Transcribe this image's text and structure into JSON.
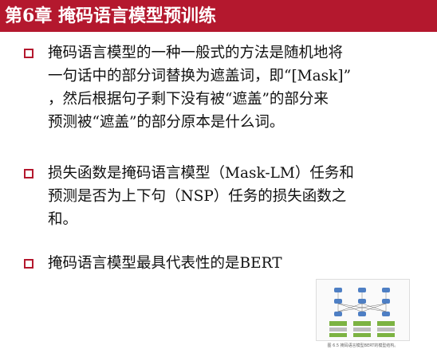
{
  "slide": {
    "title": "第6章 掩码语言模型预训练",
    "bullets": [
      {
        "lines": [
          "掩码语言模型的一种一般式的方法是随机地将",
          "一句话中的部分词替换为遮盖词，即“[Mask]”",
          "，然后根据句子剩下没有被“遮盖”的部分来",
          "预测被“遮盖”的部分原本是什么词。"
        ]
      },
      {
        "lines": [
          "损失函数是掩码语言模型（Mask-LM）任务和",
          "预测是否为上下句（NSP）任务的损失函数之",
          "和。"
        ]
      },
      {
        "lines": [
          "掩码语言模型最具代表性的是BERT"
        ]
      }
    ],
    "figure": {
      "caption": "图 6.5 掩码语言模型BERT的模型结构。",
      "colors": {
        "blue": "#4e7fc4",
        "green": "#7cb342",
        "gray": "#bdbdbd"
      }
    },
    "accent_color": "#b4182e"
  }
}
